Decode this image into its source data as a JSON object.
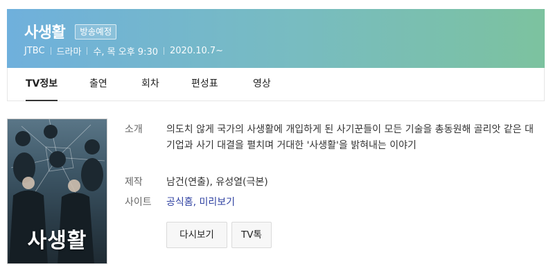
{
  "program": {
    "title": "사생활",
    "status_badge": "방송예정",
    "meta": [
      "JTBC",
      "드라마",
      "수, 목 오후 9:30",
      "2020.10.7~"
    ]
  },
  "tabs": [
    {
      "label": "TV정보",
      "active": true
    },
    {
      "label": "출연",
      "active": false
    },
    {
      "label": "회차",
      "active": false
    },
    {
      "label": "편성표",
      "active": false
    },
    {
      "label": "영상",
      "active": false
    }
  ],
  "poster": {
    "title_text": "사생활"
  },
  "info": {
    "intro_label": "소개",
    "intro_text": "의도치 않게 국가의 사생활에 개입하게 된 사기꾼들이 모든 기술을 총동원해 골리앗 같은 대기업과 사기 대결을 펼치며 거대한 '사생활'을 밝혀내는 이야기",
    "production_label": "제작",
    "production_text": "남건(연출), 유성열(극본)",
    "site_label": "사이트",
    "site_link_1": "공식홈",
    "site_separator": ", ",
    "site_link_2": "미리보기"
  },
  "buttons": {
    "replay": "다시보기",
    "tv_talk": "TV톡"
  },
  "colors": {
    "header_gradient_start": "#6fb0dc",
    "header_gradient_end": "#7cc29f",
    "link": "#2d3fa0"
  }
}
